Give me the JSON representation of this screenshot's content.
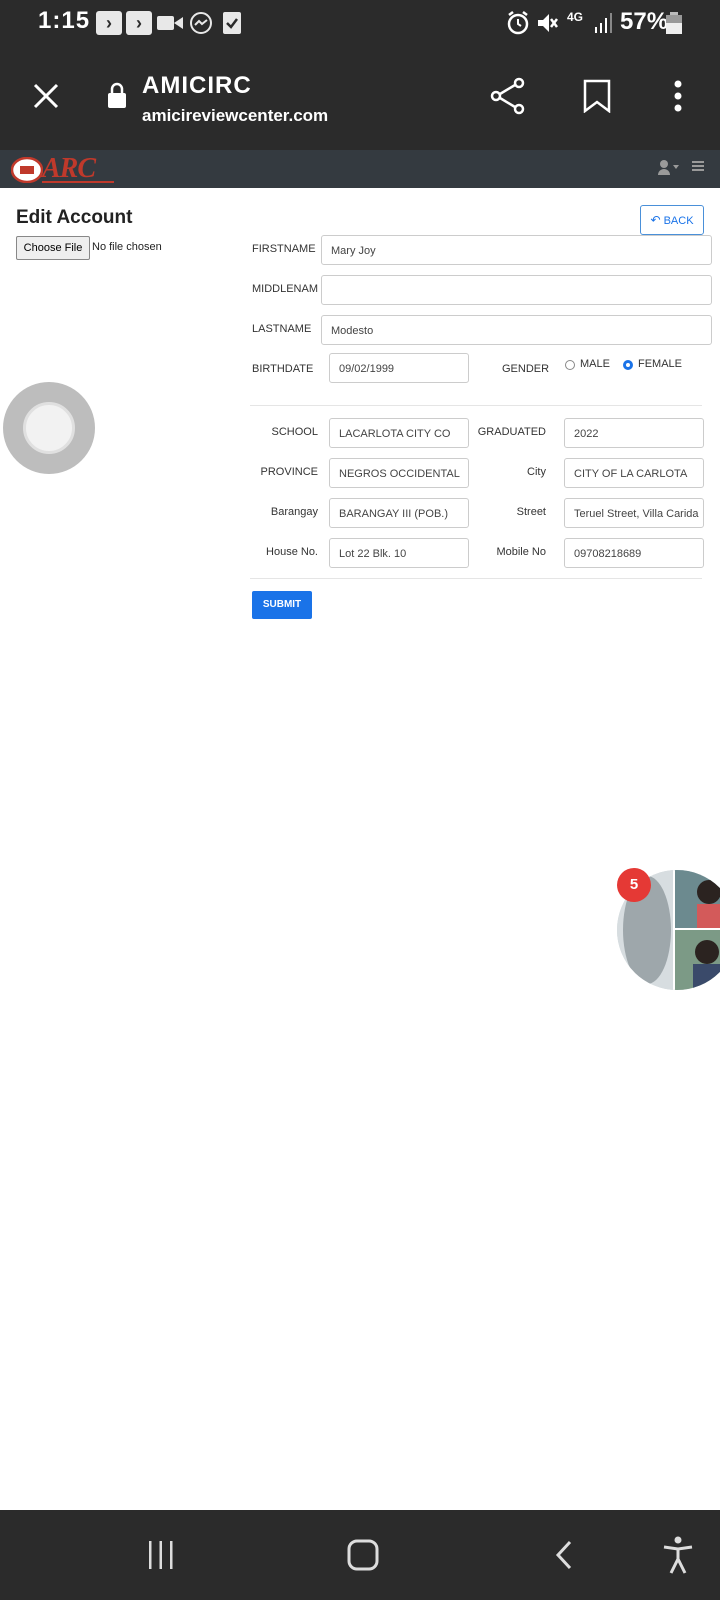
{
  "status_bar": {
    "time": "1:15",
    "network": "4G",
    "battery": "57%"
  },
  "browser": {
    "title": "AMICIRC",
    "url": "amicireviewcenter.com"
  },
  "site": {
    "logo": "ARC"
  },
  "page": {
    "title": "Edit Account",
    "choose_file_label": "Choose File",
    "no_file_text": "No file chosen",
    "back_label": "BACK",
    "submit_label": "SUBMIT"
  },
  "form": {
    "firstname": {
      "label": "FIRSTNAME",
      "value": "Mary Joy"
    },
    "middlename": {
      "label": "MIDDLENAM",
      "value": ""
    },
    "lastname": {
      "label": "LASTNAME",
      "value": "Modesto"
    },
    "birthdate": {
      "label": "BIRTHDATE",
      "value": "09/02/1999"
    },
    "gender": {
      "label": "GENDER",
      "options": [
        "MALE",
        "FEMALE"
      ],
      "selected": "FEMALE"
    },
    "school": {
      "label": "SCHOOL",
      "value": "LACARLOTA CITY CO"
    },
    "graduated": {
      "label": "GRADUATED",
      "value": "2022"
    },
    "province": {
      "label": "PROVINCE",
      "value": "NEGROS OCCIDENTAL"
    },
    "city": {
      "label": "City",
      "value": "CITY OF LA CARLOTA"
    },
    "barangay": {
      "label": "Barangay",
      "value": "BARANGAY III (POB.)"
    },
    "street": {
      "label": "Street",
      "value": "Teruel Street, Villa Carida"
    },
    "house_no": {
      "label": "House No.",
      "value": "Lot 22 Blk. 10"
    },
    "mobile_no": {
      "label": "Mobile No",
      "value": "09708218689"
    }
  },
  "chat_head": {
    "badge_count": "5"
  },
  "colors": {
    "accent": "#1a73e8",
    "badge": "#e53935",
    "logo": "#c0392b",
    "navbar": "#343a40",
    "chrome": "#2b2b2b"
  },
  "icons": [
    "close-icon",
    "lock-icon",
    "share-icon",
    "bookmark-icon",
    "more-vert-icon",
    "user-icon",
    "hamburger-icon",
    "recents-icon",
    "home-icon",
    "back-icon",
    "accessibility-icon"
  ]
}
